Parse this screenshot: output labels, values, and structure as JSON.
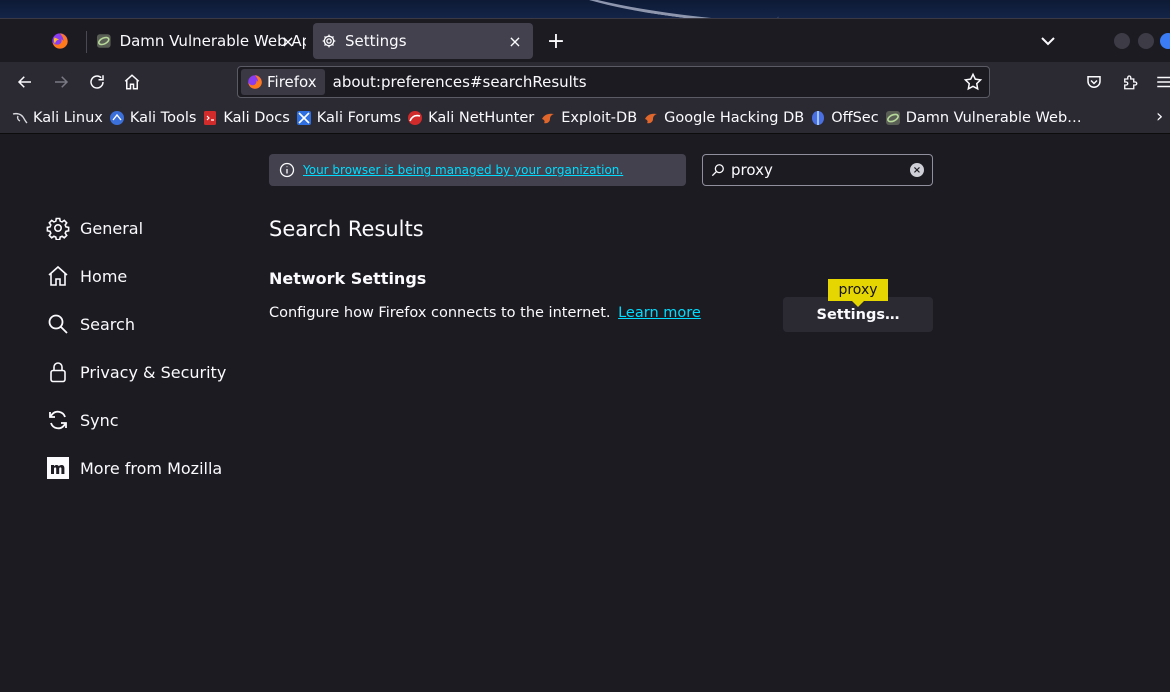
{
  "tabs": [
    {
      "title": ""
    },
    {
      "title": "Damn Vulnerable Web Ap"
    },
    {
      "title": "Settings"
    }
  ],
  "tab_close_glyph": "×",
  "new_tab_glyph": "+",
  "navbar": {
    "identity_label": "Firefox",
    "url": "about:preferences#searchResults"
  },
  "bookmarks": [
    {
      "label": "Kali Linux",
      "icon": "kali-dragon-icon",
      "color": "#ffffff"
    },
    {
      "label": "Kali Tools",
      "icon": "kali-tools-icon",
      "color": "#3b6fd9"
    },
    {
      "label": "Kali Docs",
      "icon": "kali-docs-icon",
      "color": "#d12b2b"
    },
    {
      "label": "Kali Forums",
      "icon": "kali-forums-icon",
      "color": "#2f6fe0"
    },
    {
      "label": "Kali NetHunter",
      "icon": "kali-nethunter-icon",
      "color": "#d12b2b"
    },
    {
      "label": "Exploit-DB",
      "icon": "exploit-db-icon",
      "color": "#e0662b"
    },
    {
      "label": "Google Hacking DB",
      "icon": "ghdb-icon",
      "color": "#e0662b"
    },
    {
      "label": "OffSec",
      "icon": "offsec-icon",
      "color": "#4a6fe0"
    },
    {
      "label": "Damn Vulnerable Web…",
      "icon": "dvwa-icon",
      "color": "#9ad07a"
    }
  ],
  "bookmarks_overflow": "›",
  "content": {
    "managed_notice": "Your browser is being managed by your organization.",
    "search_value": "proxy",
    "search_clear_glyph": "×",
    "page_title": "Search Results",
    "section_title": "Network Settings",
    "section_description": "Configure how Firefox connects to the internet.",
    "learn_more": "Learn more",
    "settings_button": "Settings…",
    "highlight_term": "proxy"
  },
  "sidebar": [
    {
      "label": "General",
      "icon": "gear-icon"
    },
    {
      "label": "Home",
      "icon": "home-icon"
    },
    {
      "label": "Search",
      "icon": "search-icon"
    },
    {
      "label": "Privacy & Security",
      "icon": "lock-icon"
    },
    {
      "label": "Sync",
      "icon": "sync-icon"
    },
    {
      "label": "More from Mozilla",
      "icon": "mozilla-icon"
    }
  ],
  "colors": {
    "accent_link": "#00ddff",
    "highlight": "#e5d500",
    "background": "#1c1b22",
    "toolbar": "#2b2a33"
  }
}
